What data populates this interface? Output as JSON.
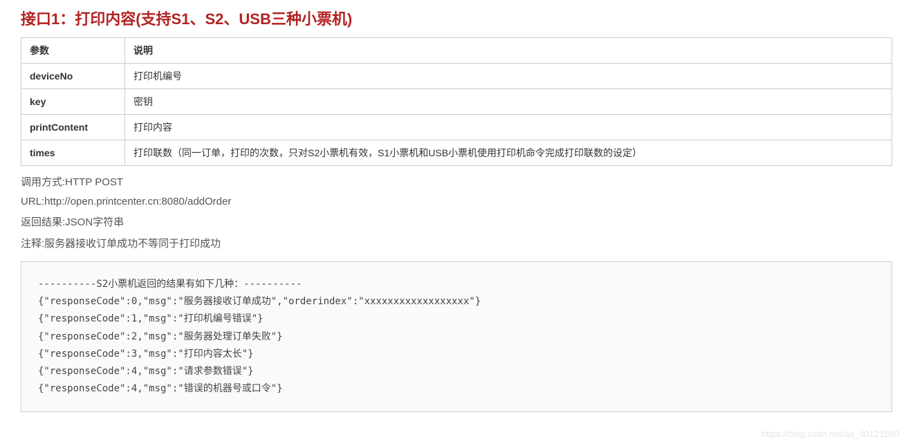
{
  "heading": "接口1：打印内容(支持S1、S2、USB三种小票机)",
  "table": {
    "header": {
      "col1": "参数",
      "col2": "说明"
    },
    "rows": [
      {
        "param": "deviceNo",
        "desc": "打印机编号"
      },
      {
        "param": "key",
        "desc": "密钥"
      },
      {
        "param": "printContent",
        "desc": "打印内容"
      },
      {
        "param": "times",
        "desc": "打印联数（同一订单，打印的次数，只对S2小票机有效，S1小票机和USB小票机使用打印机命令完成打印联数的设定）"
      }
    ]
  },
  "info": {
    "method": "调用方式:HTTP POST",
    "url": "URL:http://open.printcenter.cn:8080/addOrder",
    "result": "返回结果:JSON字符串",
    "note": "注释:服务器接收订单成功不等同于打印成功"
  },
  "code": [
    "----------S2小票机返回的结果有如下几种：----------",
    "{\"responseCode\":0,\"msg\":\"服务器接收订单成功\",\"orderindex\":\"xxxxxxxxxxxxxxxxxx\"}",
    "{\"responseCode\":1,\"msg\":\"打印机编号错误\"}",
    "{\"responseCode\":2,\"msg\":\"服务器处理订单失败\"}",
    "{\"responseCode\":3,\"msg\":\"打印内容太长\"}",
    "{\"responseCode\":4,\"msg\":\"请求参数错误\"}",
    "{\"responseCode\":4,\"msg\":\"错误的机器号或口令\"}"
  ],
  "watermark": "https://blog.csdn.net/qq_40121580"
}
